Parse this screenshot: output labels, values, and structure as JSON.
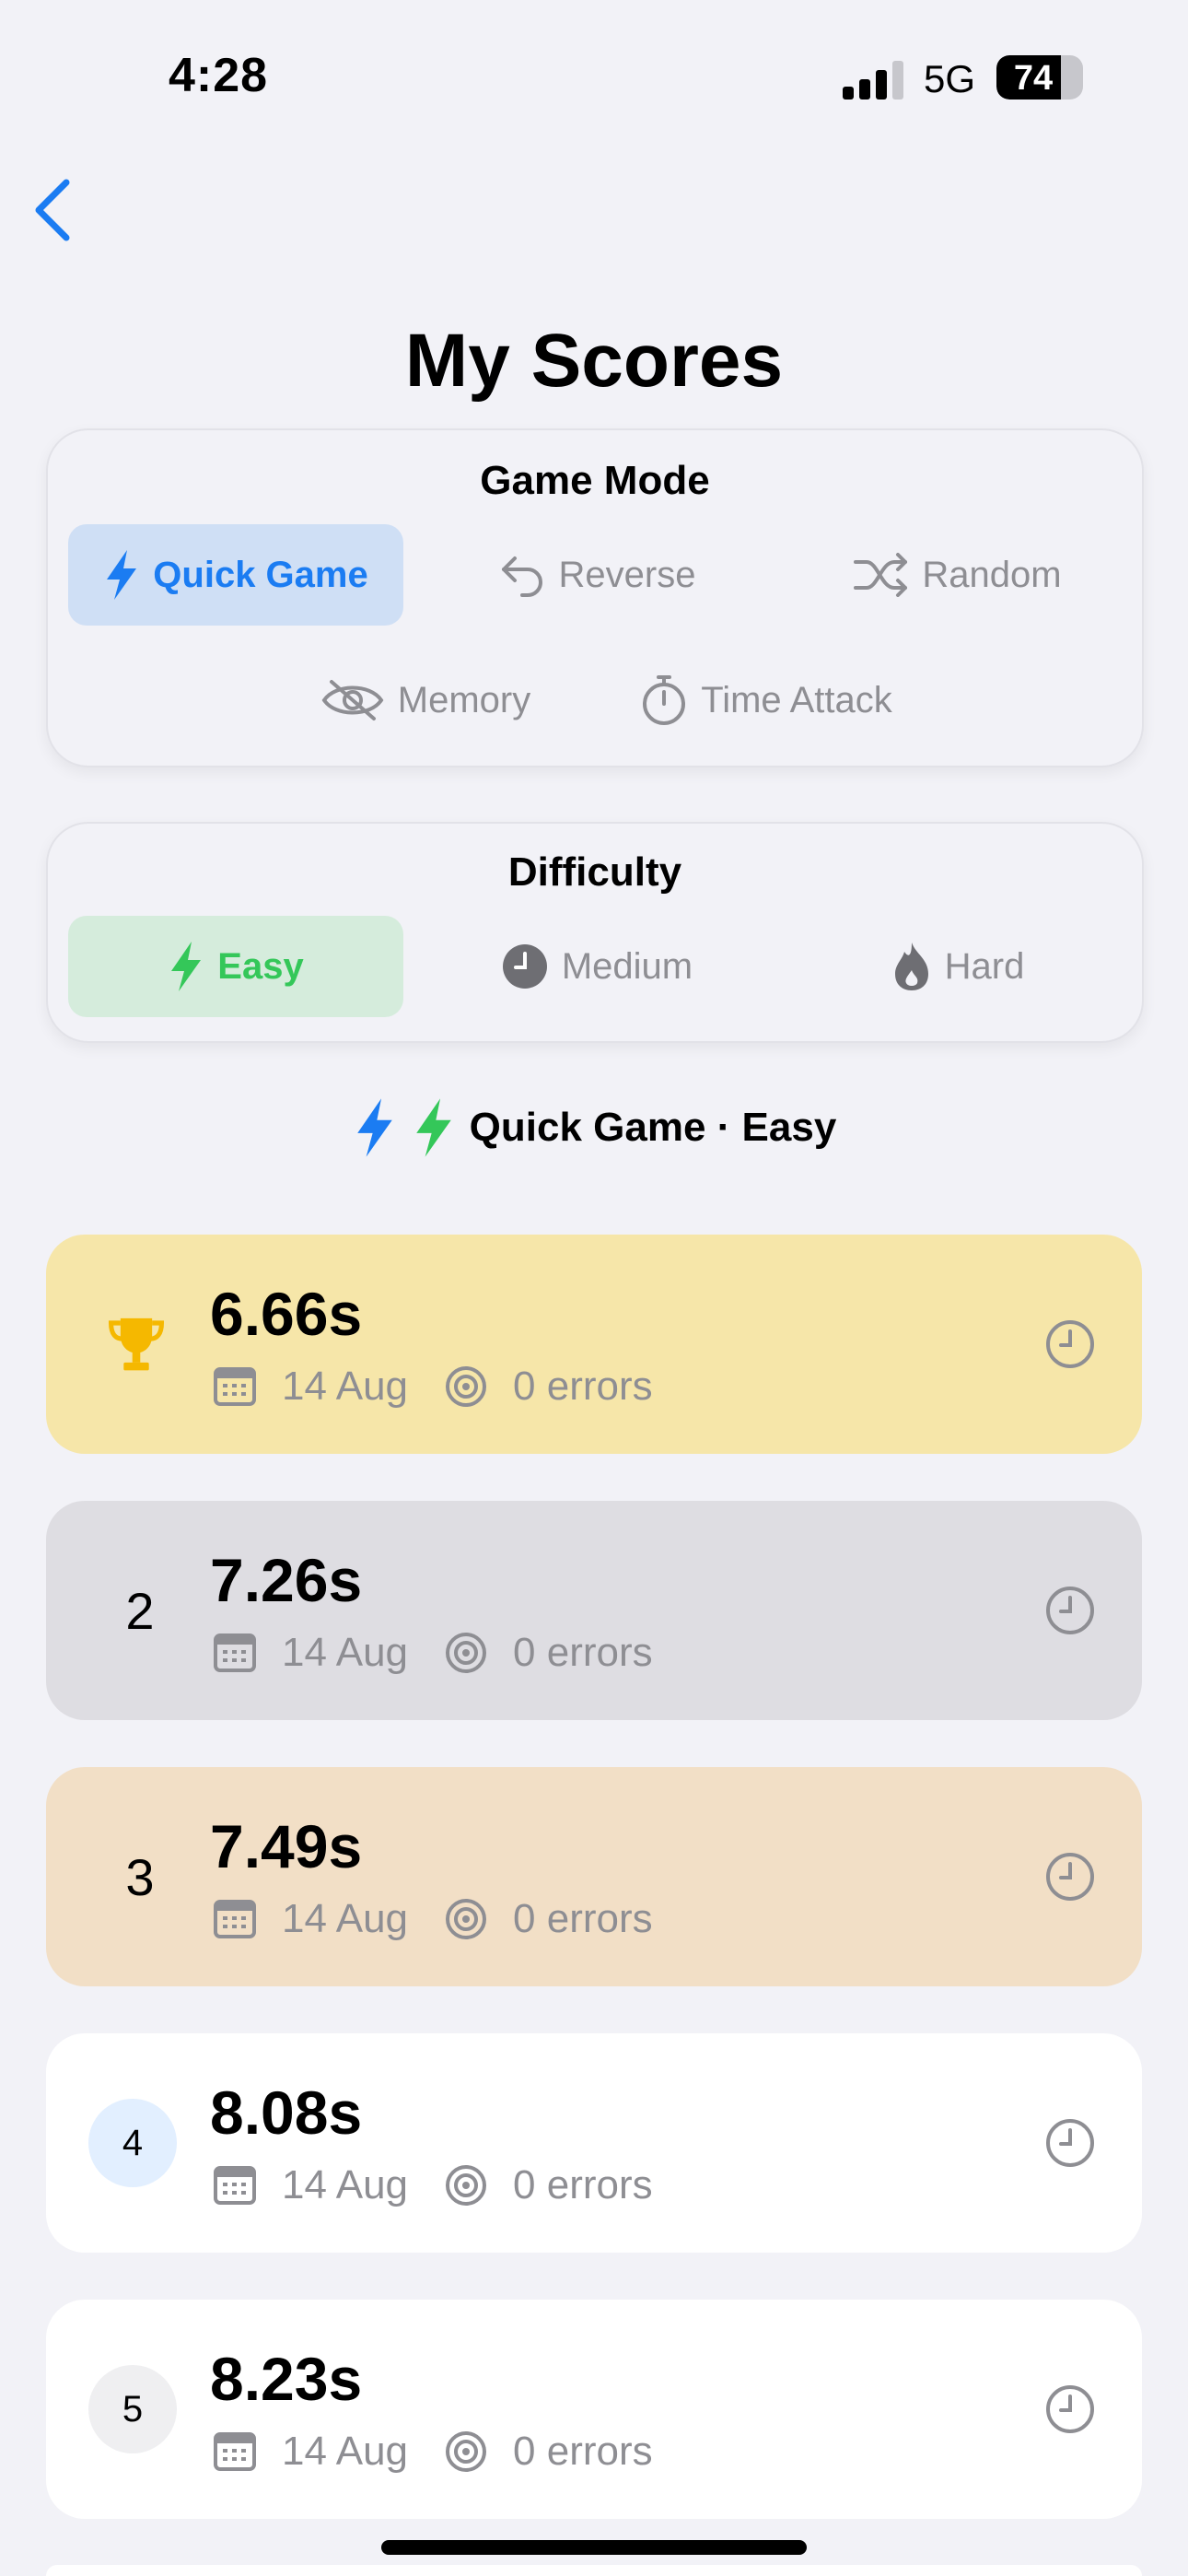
{
  "status": {
    "time": "4:28",
    "network": "5G",
    "battery": "74",
    "battery_level": 0.74
  },
  "page_title": "My Scores",
  "game_mode": {
    "title": "Game Mode",
    "options": [
      {
        "label": "Quick Game",
        "icon": "bolt-icon",
        "selected": true
      },
      {
        "label": "Reverse",
        "icon": "undo-arrow-icon",
        "selected": false
      },
      {
        "label": "Random",
        "icon": "shuffle-icon",
        "selected": false
      },
      {
        "label": "Memory",
        "icon": "eye-slash-icon",
        "selected": false
      },
      {
        "label": "Time Attack",
        "icon": "stopwatch-icon",
        "selected": false
      }
    ]
  },
  "difficulty": {
    "title": "Difficulty",
    "options": [
      {
        "label": "Easy",
        "icon": "bolt-icon",
        "selected": true
      },
      {
        "label": "Medium",
        "icon": "gauge-icon",
        "selected": false
      },
      {
        "label": "Hard",
        "icon": "flame-icon",
        "selected": false
      }
    ]
  },
  "summary": {
    "text": "Quick Game · Easy"
  },
  "scores": [
    {
      "rank": "1",
      "rank_icon": "trophy-icon",
      "time": "6.66s",
      "date": "14 Aug",
      "errors": "0 errors",
      "bg": "#f6e6a9"
    },
    {
      "rank": "2",
      "time": "7.26s",
      "date": "14 Aug",
      "errors": "0 errors",
      "bg": "#deddE2"
    },
    {
      "rank": "3",
      "time": "7.49s",
      "date": "14 Aug",
      "errors": "0 errors",
      "bg": "#f2dfc6"
    },
    {
      "rank": "4",
      "time": "8.08s",
      "date": "14 Aug",
      "errors": "0 errors",
      "bg": "#ffffff"
    },
    {
      "rank": "5",
      "time": "8.23s",
      "date": "14 Aug",
      "errors": "0 errors",
      "bg": "#ffffff"
    }
  ],
  "colors": {
    "accent_blue": "#1b7cf2",
    "accent_green": "#34c759",
    "trophy": "#f5b800",
    "secondary": "#8e8e93"
  }
}
